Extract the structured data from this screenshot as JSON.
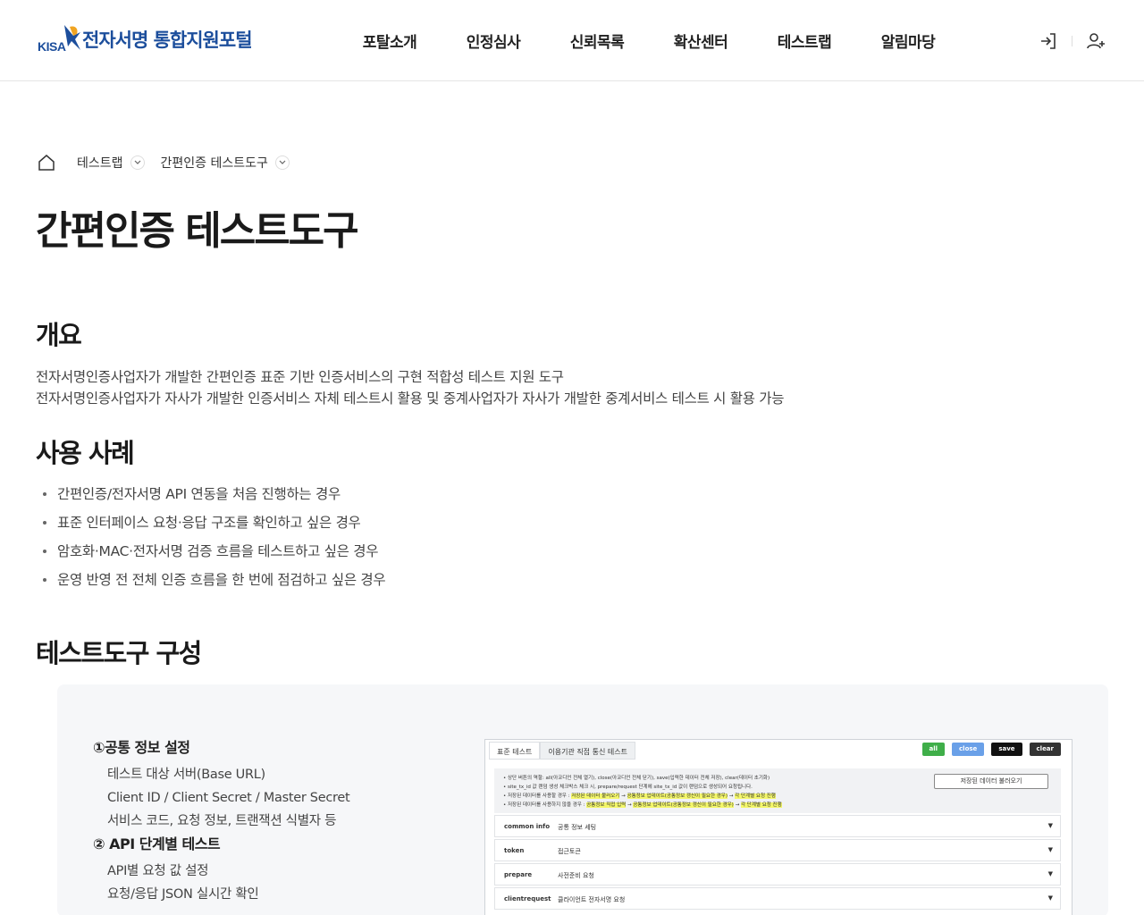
{
  "header": {
    "logo_kisa": "KISA",
    "logo_title": "전자서명 통합지원포털",
    "nav": [
      "포탈소개",
      "인정심사",
      "신뢰목록",
      "확산센터",
      "테스트랩",
      "알림마당"
    ],
    "login_icon": "login-icon",
    "signup_icon": "user-plus-icon"
  },
  "breadcrumb": {
    "home_icon": "home-icon",
    "items": [
      "테스트랩",
      "간편인증 테스트도구"
    ]
  },
  "page": {
    "title": "간편인증 테스트도구"
  },
  "overview": {
    "heading": "개요",
    "lines": [
      "전자서명인증사업자가 개발한 간편인증 표준 기반 인증서비스의 구현 적합성 테스트 지원 도구",
      "전자서명인증사업자가 자사가 개발한 인증서비스 자체 테스트시 활용 및 중계사업자가 자사가 개발한 중계서비스 테스트 시 활용 가능"
    ]
  },
  "use_cases": {
    "heading": "사용 사례",
    "items": [
      "간편인증/전자서명 API 연동을 처음 진행하는 경우",
      "표준 인터페이스 요청·응답 구조를 확인하고 싶은 경우",
      "암호화·MAC·전자서명 검증 흐름을 테스트하고 싶은 경우",
      "운영 반영 전 전체 인증 흐름을 한 번에 점검하고 싶은 경우"
    ]
  },
  "tool": {
    "heading": "테스트도구 구성",
    "steps": [
      {
        "title": "①공통 정보 설정",
        "lines": [
          "테스트 대상 서버(Base URL)",
          "Client ID / Client Secret / Master Secret",
          "서비스 코드, 요청 정보, 트랜잭션 식별자 등"
        ]
      },
      {
        "title": "② API 단계별 테스트",
        "lines": [
          "API별 요청 값 설정",
          "요청/응답 JSON 실시간 확인"
        ]
      }
    ],
    "mock": {
      "tabs": [
        "표준 테스트",
        "이용기관 직접 통신 테스트"
      ],
      "buttons": [
        {
          "label": "all",
          "color": "#3fae49"
        },
        {
          "label": "close",
          "color": "#6aa0e8"
        },
        {
          "label": "save",
          "color": "#111111"
        },
        {
          "label": "clear",
          "color": "#333333"
        }
      ],
      "notes": [
        "• 상단 버튼의 역할: all(아코디언 전체 열기), close(아코디언 전체 닫기), save(입력한 데이터 전체 저장), clear(데이터 초기화)",
        "• site_tx_id 값 랜덤 생성 체크박스 체크 시, prepare/request 단계에 site_tx_id 값이 랜덤으로 생성되어 요청됩니다.",
        "• 저장된 데이터를 사용할 경우 :",
        "• 저장된 데이터를 사용하지 않을 경우 :"
      ],
      "flow_saved": [
        "저장된 데이터 불러오기",
        "→",
        "공통정보 업데이트(공통정보 갱신이 필요한 경우)",
        "→",
        "각 단계별 요청 진행"
      ],
      "flow_unsaved": [
        "공통정보 직접 입력",
        "→",
        "공통정보 업데이트(공통정보 갱신이 필요한 경우)",
        "→",
        "각 단계별 요청 진행"
      ],
      "load_button": "저장된 데이터 불러오기",
      "rows": [
        {
          "key": "common info",
          "value": "공통 정보 세팅"
        },
        {
          "key": "token",
          "value": "접근토큰"
        },
        {
          "key": "prepare",
          "value": "사전준비 요청"
        },
        {
          "key": "clientrequest",
          "value": "클라이언트 전자서명 요청"
        }
      ],
      "caret": "▼"
    }
  }
}
